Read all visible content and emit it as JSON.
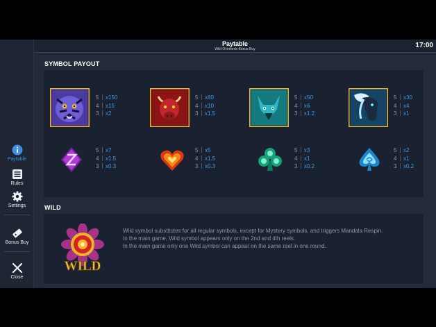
{
  "header": {
    "title": "Paytable",
    "subtitle": "Wild Overlords Bonus Buy",
    "clock": "17:00"
  },
  "sidebar": {
    "items": [
      {
        "label": "Paytable",
        "icon": "info-icon",
        "active": true
      },
      {
        "label": "Rules",
        "icon": "list-icon",
        "active": false
      },
      {
        "label": "Settings",
        "icon": "gear-icon",
        "active": false
      },
      {
        "label": "Bonus Buy",
        "icon": "ticket-icon",
        "active": false
      },
      {
        "label": "Close",
        "icon": "close-icon",
        "active": false
      }
    ]
  },
  "symbol_payout": {
    "title": "SYMBOL PAYOUT",
    "symbols": [
      {
        "name": "tiger",
        "payouts": [
          {
            "count": "5",
            "value": "x150"
          },
          {
            "count": "4",
            "value": "x15"
          },
          {
            "count": "3",
            "value": "x2"
          }
        ]
      },
      {
        "name": "bull",
        "payouts": [
          {
            "count": "5",
            "value": "x80"
          },
          {
            "count": "4",
            "value": "x10"
          },
          {
            "count": "3",
            "value": "x1.5"
          }
        ]
      },
      {
        "name": "wolf",
        "payouts": [
          {
            "count": "5",
            "value": "x50"
          },
          {
            "count": "4",
            "value": "x6"
          },
          {
            "count": "3",
            "value": "x1.2"
          }
        ]
      },
      {
        "name": "horse",
        "payouts": [
          {
            "count": "5",
            "value": "x30"
          },
          {
            "count": "4",
            "value": "x4"
          },
          {
            "count": "3",
            "value": "x1"
          }
        ]
      },
      {
        "name": "diamond",
        "payouts": [
          {
            "count": "5",
            "value": "x7"
          },
          {
            "count": "4",
            "value": "x1.5"
          },
          {
            "count": "3",
            "value": "x0.3"
          }
        ]
      },
      {
        "name": "heart",
        "payouts": [
          {
            "count": "5",
            "value": "x5"
          },
          {
            "count": "4",
            "value": "x1.5"
          },
          {
            "count": "3",
            "value": "x0.3"
          }
        ]
      },
      {
        "name": "club",
        "payouts": [
          {
            "count": "5",
            "value": "x3"
          },
          {
            "count": "4",
            "value": "x1"
          },
          {
            "count": "3",
            "value": "x0.2"
          }
        ]
      },
      {
        "name": "spade",
        "payouts": [
          {
            "count": "5",
            "value": "x2"
          },
          {
            "count": "4",
            "value": "x1"
          },
          {
            "count": "3",
            "value": "x0.2"
          }
        ]
      }
    ]
  },
  "wild": {
    "title": "WILD",
    "logo_text": "WILD",
    "lines": [
      "Wild symbol substitutes for all regular symbols, except for Mystery symbols, and triggers Mandala Respin.",
      "In the main game, Wild symbol appears only on the 2nd and 4th reels.",
      "In the main game only one Wild symbol can appear on the same reel in one round."
    ]
  },
  "colors": {
    "accent": "#3f9ae6",
    "panel": "#1a2130",
    "background": "#232b3a",
    "gold": "#e8b52b"
  }
}
